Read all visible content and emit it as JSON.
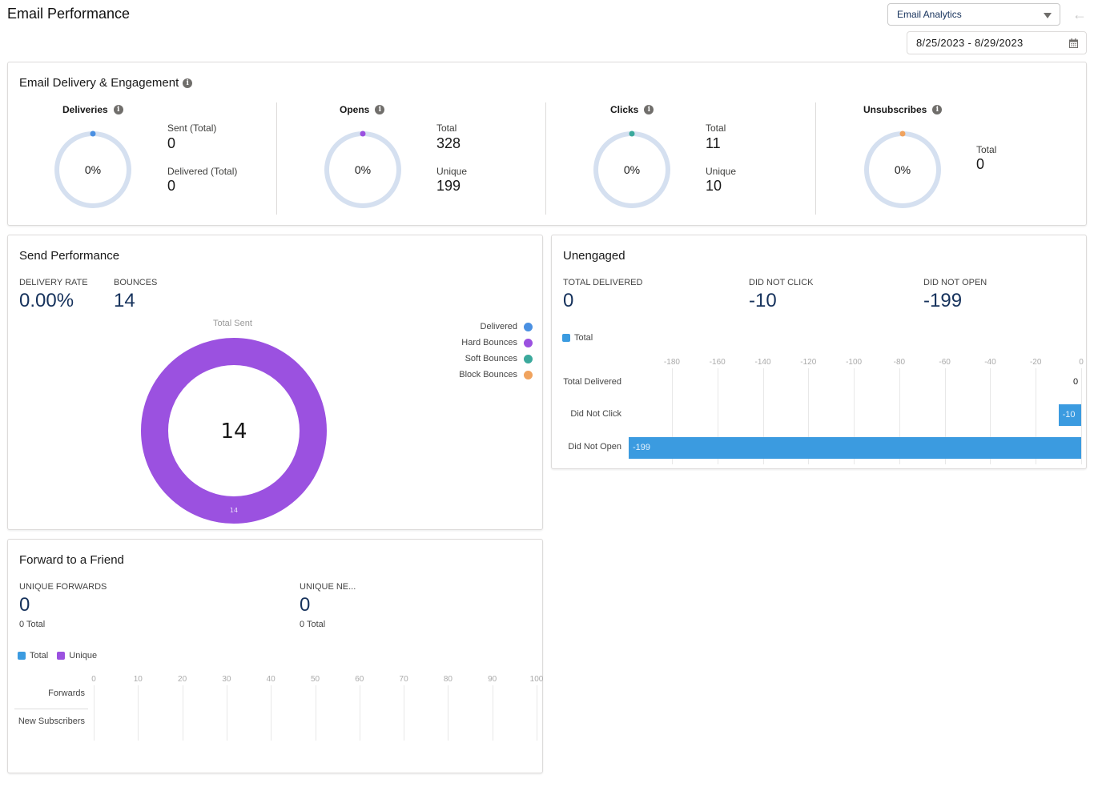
{
  "header": {
    "title": "Email Performance",
    "app_select": "Email Analytics",
    "date_range": "8/25/2023 - 8/29/2023",
    "back_icon": "arrow-left-icon",
    "calendar_icon": "calendar-icon"
  },
  "engagement": {
    "title": "Email Delivery & Engagement",
    "metrics": [
      {
        "name": "Deliveries",
        "percent": "0%",
        "color": "#4a90e2",
        "stats": [
          {
            "label": "Sent (Total)",
            "value": "0"
          },
          {
            "label": "Delivered (Total)",
            "value": "0"
          }
        ]
      },
      {
        "name": "Opens",
        "percent": "0%",
        "color": "#9b51e0",
        "stats": [
          {
            "label": "Total",
            "value": "328"
          },
          {
            "label": "Unique",
            "value": "199"
          }
        ]
      },
      {
        "name": "Clicks",
        "percent": "0%",
        "color": "#3ba99c",
        "stats": [
          {
            "label": "Total",
            "value": "11"
          },
          {
            "label": "Unique",
            "value": "10"
          }
        ]
      },
      {
        "name": "Unsubscribes",
        "percent": "0%",
        "color": "#f0a35e",
        "stats": [
          {
            "label": "Total",
            "value": "0"
          }
        ]
      }
    ],
    "ring_track_color": "#d5e0f0"
  },
  "send_performance": {
    "title": "Send Performance",
    "delivery_rate_label": "DELIVERY RATE",
    "delivery_rate": "0.00%",
    "bounces_label": "BOUNCES",
    "bounces": "14",
    "donut_caption": "Total Sent",
    "donut_center": "14",
    "legend": [
      {
        "label": "Delivered",
        "color": "#4a90e2"
      },
      {
        "label": "Hard Bounces",
        "color": "#9b51e0"
      },
      {
        "label": "Soft Bounces",
        "color": "#3ba99c"
      },
      {
        "label": "Block Bounces",
        "color": "#f0a35e"
      }
    ]
  },
  "unengaged": {
    "title": "Unengaged",
    "kpis": [
      {
        "label": "TOTAL DELIVERED",
        "value": "0"
      },
      {
        "label": "DID NOT CLICK",
        "value": "-10"
      },
      {
        "label": "DID NOT OPEN",
        "value": "-199"
      }
    ],
    "legend_label": "Total",
    "bar_color": "#3b9be0"
  },
  "forward": {
    "title": "Forward to a Friend",
    "kpis": [
      {
        "label": "UNIQUE FORWARDS",
        "value": "0",
        "sub": "0 Total"
      },
      {
        "label": "UNIQUE NE...",
        "value": "0",
        "sub": "0 Total"
      }
    ],
    "legend": [
      {
        "label": "Total",
        "color": "#3b9be0"
      },
      {
        "label": "Unique",
        "color": "#9b51e0"
      }
    ]
  },
  "chart_data": [
    {
      "type": "pie",
      "title": "Total Sent",
      "categories": [
        "Delivered",
        "Hard Bounces",
        "Soft Bounces",
        "Block Bounces"
      ],
      "values": [
        0,
        14,
        0,
        0
      ],
      "center_label": "14",
      "legend": "right"
    },
    {
      "type": "bar",
      "orientation": "horizontal",
      "categories": [
        "Total Delivered",
        "Did Not Click",
        "Did Not Open"
      ],
      "series": [
        {
          "name": "Total",
          "values": [
            0,
            -10,
            -199
          ]
        }
      ],
      "xlim": [
        -199,
        0
      ],
      "xticks": [
        -180,
        -160,
        -140,
        -120,
        -100,
        -80,
        -60,
        -40,
        -20,
        0
      ],
      "legend": "top-left",
      "grid": true
    },
    {
      "type": "bar",
      "orientation": "horizontal",
      "categories": [
        "Forwards",
        "New Subscribers"
      ],
      "series": [
        {
          "name": "Total",
          "values": [
            0,
            0
          ]
        },
        {
          "name": "Unique",
          "values": [
            0,
            0
          ]
        }
      ],
      "xlim": [
        0,
        100
      ],
      "xticks": [
        0,
        10,
        20,
        30,
        40,
        50,
        60,
        70,
        80,
        90,
        100
      ],
      "legend": "top-left",
      "grid": true
    }
  ]
}
